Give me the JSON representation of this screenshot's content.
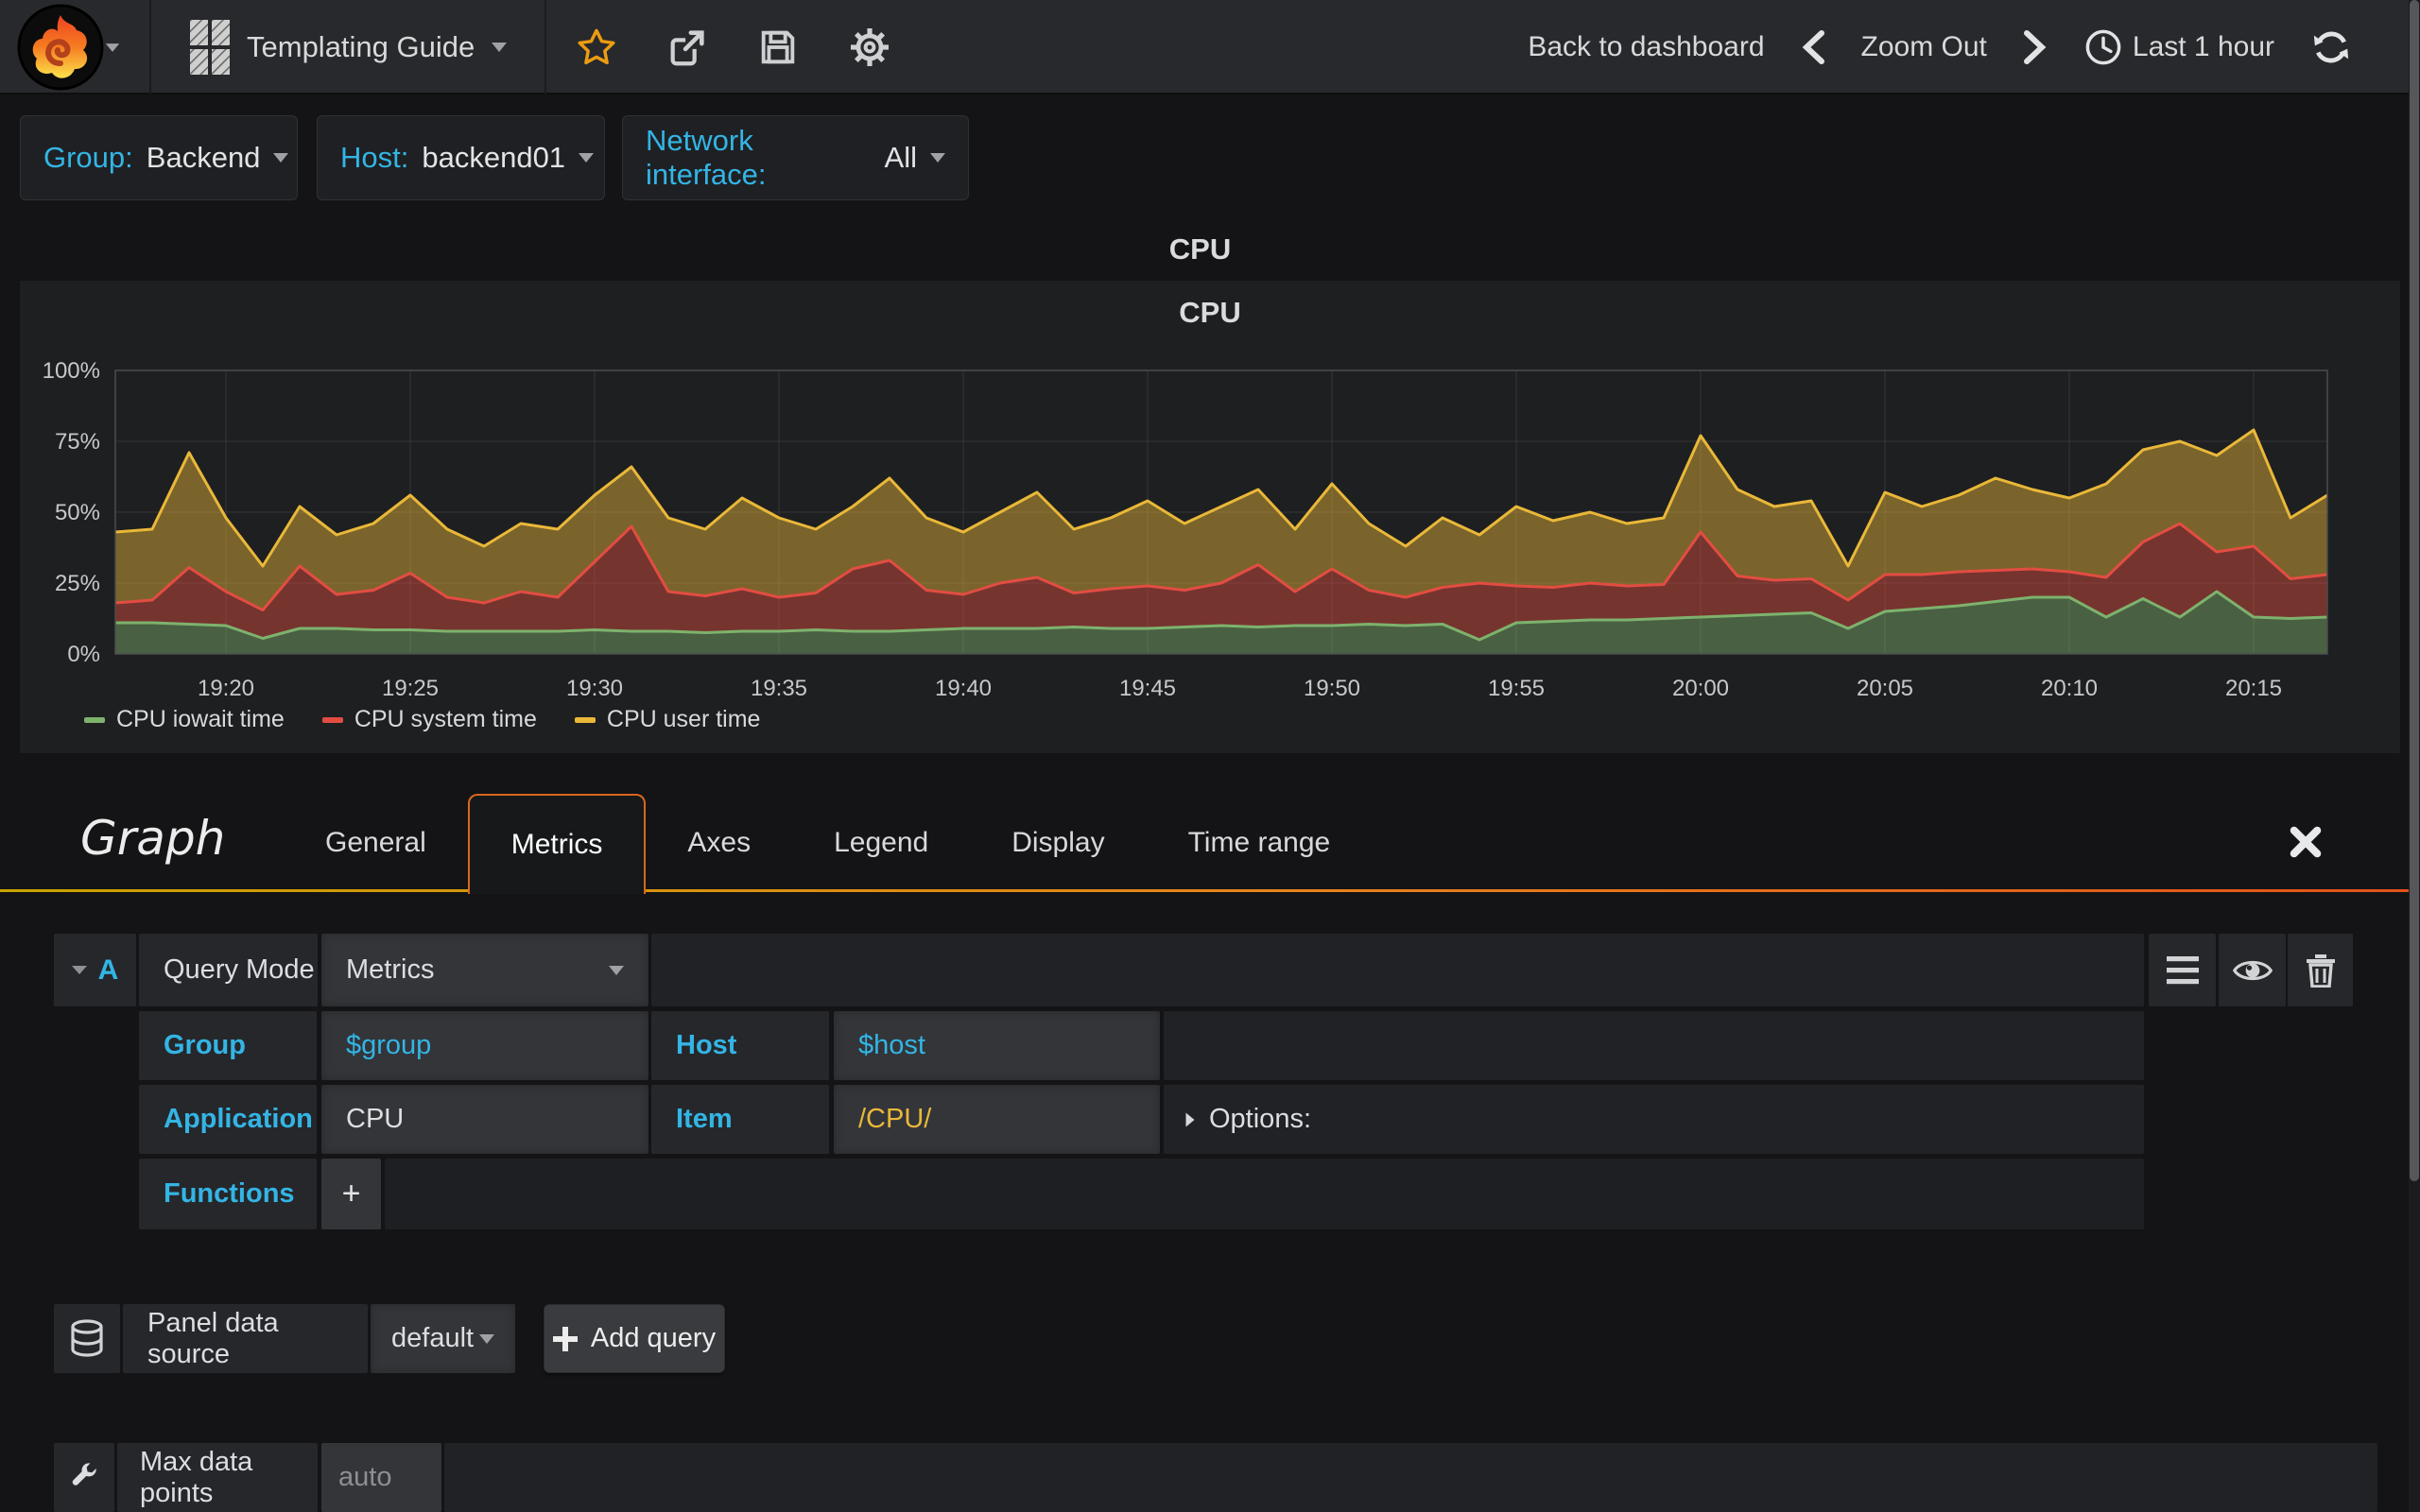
{
  "navbar": {
    "dashboard_title": "Templating Guide",
    "back_label": "Back to dashboard",
    "zoom_out_label": "Zoom Out",
    "time_range_label": "Last 1 hour"
  },
  "variables": [
    {
      "label": "Group:",
      "value": "Backend"
    },
    {
      "label": "Host:",
      "value": "backend01"
    },
    {
      "label": "Network interface:",
      "value": "All"
    }
  ],
  "panel": {
    "row_title": "CPU",
    "title": "CPU"
  },
  "chart_data": {
    "type": "area",
    "stacked": true,
    "title": "CPU",
    "unit": "percent",
    "ylim": [
      0,
      100
    ],
    "y_ticks": [
      "0%",
      "25%",
      "50%",
      "75%",
      "100%"
    ],
    "x_start": "19:17",
    "x_end": "20:17",
    "x_step_minutes": 1,
    "x_ticks": [
      "19:20",
      "19:25",
      "19:30",
      "19:35",
      "19:40",
      "19:45",
      "19:50",
      "19:55",
      "20:00",
      "20:05",
      "20:10",
      "20:15"
    ],
    "grid": true,
    "legend_position": "bottom",
    "series": [
      {
        "name": "CPU iowait time",
        "color": "#7EB26D",
        "values": [
          11,
          11,
          10.5,
          10,
          5.5,
          9,
          9,
          8.5,
          8.5,
          8,
          8,
          8,
          8,
          8.5,
          8,
          8,
          7.5,
          8,
          8,
          8.5,
          8,
          8,
          8.5,
          9,
          9,
          9,
          9.5,
          9,
          9,
          9.5,
          10,
          9.5,
          10,
          10,
          10.5,
          10,
          10.5,
          5,
          11,
          11.5,
          12,
          12,
          12.5,
          13,
          13.5,
          14,
          14.5,
          9,
          15,
          16,
          17,
          18.5,
          20,
          20,
          13,
          19.5,
          13,
          22,
          13,
          12.5,
          13
        ]
      },
      {
        "name": "CPU system time",
        "color": "#E24D42",
        "values": [
          7,
          8,
          20,
          12,
          10,
          22,
          12,
          14,
          20,
          12,
          10,
          14,
          12,
          24,
          37,
          14,
          13,
          15,
          12,
          13,
          22,
          25,
          14,
          12,
          16,
          18,
          12,
          14,
          15,
          13,
          15,
          22,
          12,
          20,
          12,
          10,
          13,
          20,
          13,
          12,
          13,
          12,
          12,
          30,
          14,
          12,
          12,
          10,
          13,
          12,
          12,
          11,
          10,
          9,
          14,
          20,
          33,
          14,
          25,
          14,
          15
        ]
      },
      {
        "name": "CPU user time",
        "color": "#EAB839",
        "values": [
          25,
          25,
          40.5,
          26,
          15.5,
          21,
          21,
          23.5,
          27.5,
          24,
          20,
          24,
          24,
          23.5,
          21,
          26,
          23.5,
          32,
          28,
          22.5,
          22,
          29,
          25.5,
          22,
          25,
          30,
          22.5,
          25,
          30,
          23.5,
          27,
          26.5,
          22,
          30,
          23.5,
          18,
          24.5,
          17,
          28,
          23.5,
          25,
          22,
          23.5,
          34,
          30.5,
          26,
          27.5,
          12,
          29,
          24,
          27,
          32.5,
          28,
          26,
          33,
          32.5,
          29,
          34,
          41,
          21.5,
          28
        ]
      }
    ]
  },
  "editor": {
    "panel_type": "Graph",
    "tabs": [
      "General",
      "Metrics",
      "Axes",
      "Legend",
      "Display",
      "Time range"
    ],
    "active_tab": "Metrics",
    "query": {
      "letter": "A",
      "mode_label": "Query Mode",
      "mode_value": "Metrics",
      "group_label": "Group",
      "group_value": "$group",
      "host_label": "Host",
      "host_value": "$host",
      "application_label": "Application",
      "application_value": "CPU",
      "item_label": "Item",
      "item_value": "/CPU/",
      "options_label": "Options:",
      "functions_label": "Functions",
      "add_function_label": "+"
    },
    "datasource": {
      "label": "Panel data source",
      "value": "default",
      "add_query_label": "Add query"
    },
    "max_data_points": {
      "label": "Max data points",
      "placeholder": "auto"
    }
  }
}
